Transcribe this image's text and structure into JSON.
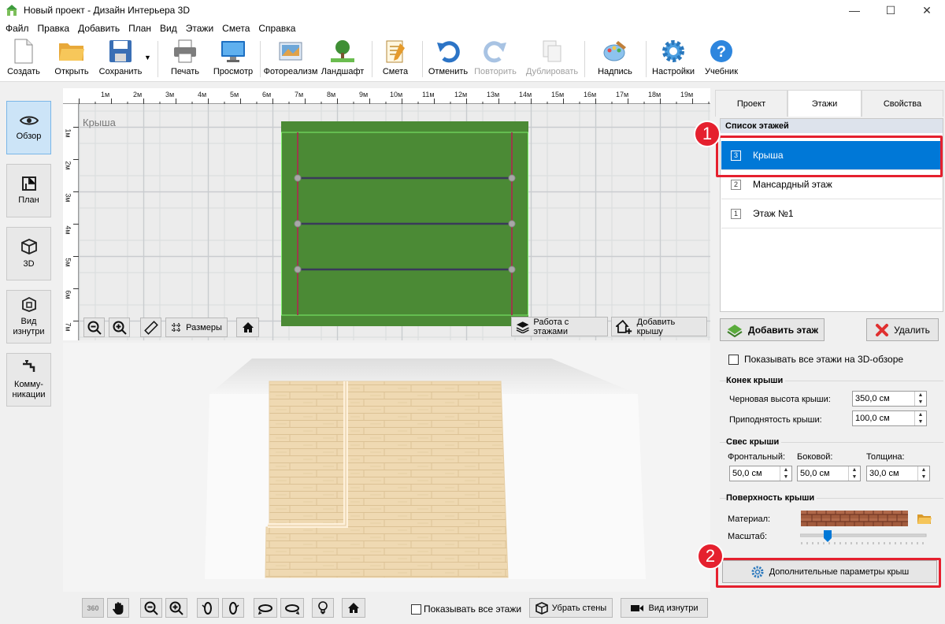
{
  "window": {
    "title": "Новый проект - Дизайн Интерьера 3D",
    "controls": [
      "—",
      "☐",
      "✕"
    ]
  },
  "menu": [
    "Файл",
    "Правка",
    "Добавить",
    "План",
    "Вид",
    "Этажи",
    "Смета",
    "Справка"
  ],
  "toolbar": {
    "create": "Создать",
    "open": "Открыть",
    "save": "Сохранить",
    "print": "Печать",
    "preview": "Просмотр",
    "photoreal": "Фотореализм",
    "landscape": "Ландшафт",
    "estimate": "Смета",
    "undo": "Отменить",
    "redo": "Повторить",
    "duplicate": "Дублировать",
    "label": "Надпись",
    "settings": "Настройки",
    "tutorial": "Учебник"
  },
  "leftnav": {
    "overview": "Обзор",
    "plan": "План",
    "view3d": "3D",
    "inside_l1": "Вид",
    "inside_l2": "изнутри",
    "comm_l1": "Комму-",
    "comm_l2": "никации"
  },
  "view2d": {
    "floor_label": "Крыша",
    "ruler_top": [
      "1м",
      "2м",
      "3м",
      "4м",
      "5м",
      "6м",
      "7м",
      "8м",
      "9м",
      "10м",
      "11м",
      "12м",
      "13м",
      "14м",
      "15м",
      "16м",
      "17м",
      "18м",
      "19м"
    ],
    "ruler_left": [
      "1м",
      "2м",
      "3м",
      "4м",
      "5м",
      "6м",
      "7м"
    ],
    "sizes_button": "Размеры",
    "floors_button": "Работа с этажами",
    "add_roof_button": "Добавить крышу"
  },
  "view3d_bar": {
    "show_all_floors": "Показывать все этажи",
    "remove_walls": "Убрать стены",
    "inside_view": "Вид изнутри",
    "rotate_label": "360"
  },
  "rightpanel": {
    "tabs": [
      "Проект",
      "Этажи",
      "Свойства"
    ],
    "floor_list_header": "Список этажей",
    "floors": [
      {
        "num": "3",
        "name": "Крыша"
      },
      {
        "num": "2",
        "name": "Мансардный этаж"
      },
      {
        "num": "1",
        "name": "Этаж №1"
      }
    ],
    "add_floor": "Добавить этаж",
    "delete": "Удалить",
    "show_all_3d": "Показывать все этажи на 3D-обзоре",
    "ridge": {
      "title": "Конек крыши",
      "rough_height_label": "Черновая высота крыши:",
      "rough_height": "350,0 см",
      "elevation_label": "Приподнятость крыши:",
      "elevation": "100,0 см"
    },
    "overhang": {
      "title": "Свес крыши",
      "front_label": "Фронтальный:",
      "front": "50,0 см",
      "side_label": "Боковой:",
      "side": "50,0 см",
      "thickness_label": "Толщина:",
      "thickness": "30,0 см"
    },
    "surface": {
      "title": "Поверхность крыши",
      "material_label": "Материал:",
      "scale_label": "Масштаб:",
      "scale_value": 0.2
    },
    "extra_params": "Дополнительные параметры крыш"
  },
  "annotations": {
    "badge1": "1",
    "badge2": "2"
  },
  "colors": {
    "selection": "#0078d7",
    "roof_green": "#4b8a35",
    "annotation_red": "#e5202e"
  }
}
